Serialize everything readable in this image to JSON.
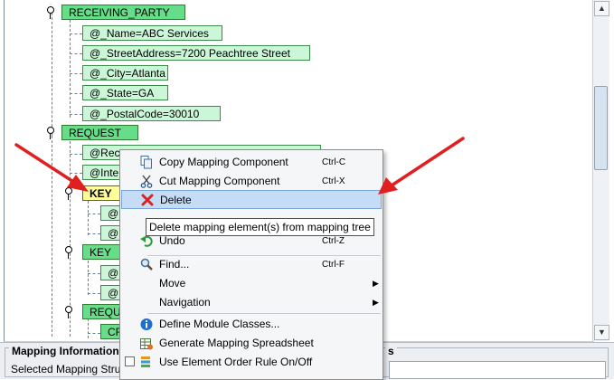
{
  "tree": {
    "receiving_party": "RECEIVING_PARTY",
    "name_attr": "@_Name=ABC Services",
    "street_attr": "@_StreetAddress=7200 Peachtree Street",
    "city_attr": "@_City=Atlanta",
    "state_attr": "@_State=GA",
    "postal_attr": "@_PostalCode=30010",
    "request": "REQUEST",
    "req_attr_1": "@Rec",
    "req_attr_2": "@Inte",
    "key_1": "KEY",
    "key_1_child_1": "@",
    "key_1_child_2": "@",
    "key_2": "KEY",
    "key_2_child_1": "@",
    "key_2_child_2": "@",
    "requ_elem": "REQU",
    "cr_elem": "CR"
  },
  "context_menu": {
    "items": [
      {
        "label": "Copy Mapping Component",
        "shortcut": "Ctrl-C",
        "icon": "copy-icon"
      },
      {
        "label": "Cut Mapping Component",
        "shortcut": "Ctrl-X",
        "icon": "scissors-icon"
      },
      {
        "label": "Delete",
        "shortcut": "",
        "icon": "red-x-icon"
      },
      {
        "label": "Undo",
        "shortcut": "Ctrl-Z",
        "icon": "undo-icon"
      },
      {
        "label": "Find...",
        "shortcut": "Ctrl-F",
        "icon": "magnifier-icon"
      },
      {
        "label": "Move",
        "shortcut": "",
        "icon": ""
      },
      {
        "label": "Navigation",
        "shortcut": "",
        "icon": ""
      },
      {
        "label": "Define Module Classes...",
        "shortcut": "",
        "icon": "info-icon"
      },
      {
        "label": "Generate Mapping Spreadsheet",
        "shortcut": "",
        "icon": "spreadsheet-icon"
      },
      {
        "label": "Use Element Order Rule On/Off",
        "shortcut": "",
        "icon": "element-order-icon"
      }
    ],
    "selected": "Delete"
  },
  "tooltip": "Delete mapping element(s) from mapping tree",
  "bottom": {
    "legend": "Mapping Information",
    "legend_right": "s",
    "selected_label": "Selected Mapping Stru"
  },
  "colors": {
    "element_fill": "#66dd88",
    "attribute_fill": "#ccf6d8",
    "key_highlight": "#ffff99",
    "menu_selection": "#c5dcf6",
    "annotation_arrow": "#e02020"
  }
}
